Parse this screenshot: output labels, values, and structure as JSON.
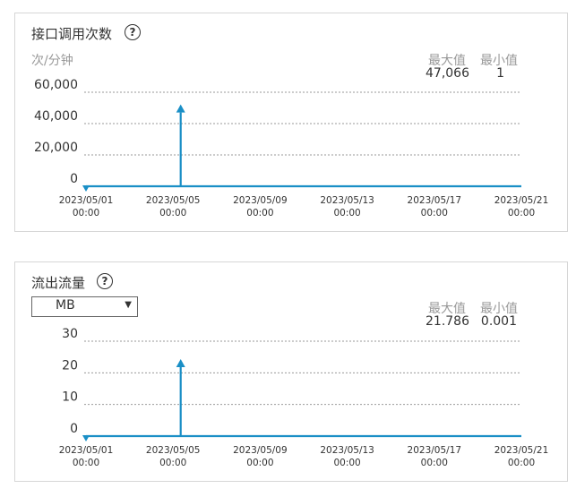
{
  "colors": {
    "series": "#1a8fc6",
    "grid": "#999999",
    "muted": "#999999"
  },
  "panels": [
    {
      "title": "接口调用次数",
      "help_icon": "?",
      "unit": "次/分钟",
      "stats": {
        "max_label": "最大值",
        "min_label": "最小值",
        "max_value": "47,066",
        "min_value": "1"
      }
    },
    {
      "title": "流出流量",
      "help_icon": "?",
      "select": {
        "value": "MB",
        "caret": "▼"
      },
      "stats": {
        "max_label": "最大值",
        "min_label": "最小值",
        "max_value": "21.786",
        "min_value": "0.001"
      }
    }
  ],
  "chart_data": [
    {
      "type": "line",
      "title": "接口调用次数",
      "ylabel": "次/分钟",
      "yticks": [
        "60,000",
        "40,000",
        "20,000",
        "0"
      ],
      "ytick_values": [
        60000,
        40000,
        20000,
        0
      ],
      "ylim": [
        0,
        60000
      ],
      "xlim": [
        "2023/05/01 00:00",
        "2023/05/21 00:00"
      ],
      "xticks": [
        [
          "2023/05/01",
          "00:00"
        ],
        [
          "2023/05/05",
          "00:00"
        ],
        [
          "2023/05/09",
          "00:00"
        ],
        [
          "2023/05/13",
          "00:00"
        ],
        [
          "2023/05/17",
          "00:00"
        ],
        [
          "2023/05/21",
          "00:00"
        ]
      ],
      "series": [
        {
          "values": [
            [
              0,
              1
            ],
            [
              4.35,
              1
            ],
            [
              4.35,
              47066
            ],
            [
              4.35,
              1
            ],
            [
              20,
              1
            ]
          ]
        }
      ],
      "max_marker": [
        4.35,
        47066
      ],
      "min_marker": [
        0,
        1
      ],
      "grid": true
    },
    {
      "type": "line",
      "title": "流出流量",
      "ylabel": "MB",
      "yticks": [
        "30",
        "20",
        "10",
        "0"
      ],
      "ytick_values": [
        30,
        20,
        10,
        0
      ],
      "ylim": [
        0,
        30
      ],
      "xlim": [
        "2023/05/01 00:00",
        "2023/05/21 00:00"
      ],
      "xticks": [
        [
          "2023/05/01",
          "00:00"
        ],
        [
          "2023/05/05",
          "00:00"
        ],
        [
          "2023/05/09",
          "00:00"
        ],
        [
          "2023/05/13",
          "00:00"
        ],
        [
          "2023/05/17",
          "00:00"
        ],
        [
          "2023/05/21",
          "00:00"
        ]
      ],
      "series": [
        {
          "values": [
            [
              0,
              0.001
            ],
            [
              4.35,
              0.001
            ],
            [
              4.35,
              21.786
            ],
            [
              4.35,
              0.001
            ],
            [
              20,
              0.001
            ]
          ]
        }
      ],
      "max_marker": [
        4.35,
        21.786
      ],
      "min_marker": [
        0,
        0.001
      ],
      "grid": true
    }
  ]
}
